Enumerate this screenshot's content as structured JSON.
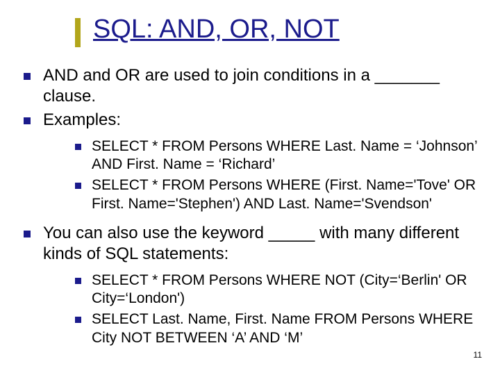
{
  "title": "SQL: AND, OR, NOT",
  "bullets": {
    "b1": "AND and OR are used to join conditions in a _______ clause.",
    "b2": "Examples:",
    "b2_sub1": "SELECT * FROM Persons WHERE Last. Name = ‘Johnson’ AND First. Name = ‘Richard’",
    "b2_sub2": "SELECT * FROM Persons WHERE (First. Name='Tove' OR First. Name='Stephen') AND Last. Name='Svendson'",
    "b3": "You can also use the keyword _____ with many different kinds of SQL statements:",
    "b3_sub1": "SELECT * FROM Persons WHERE NOT (City=‘Berlin' OR City=‘London')",
    "b3_sub2": "SELECT Last. Name, First. Name FROM Persons WHERE City NOT BETWEEN ‘A’ AND ‘M’"
  },
  "page_number": "11"
}
